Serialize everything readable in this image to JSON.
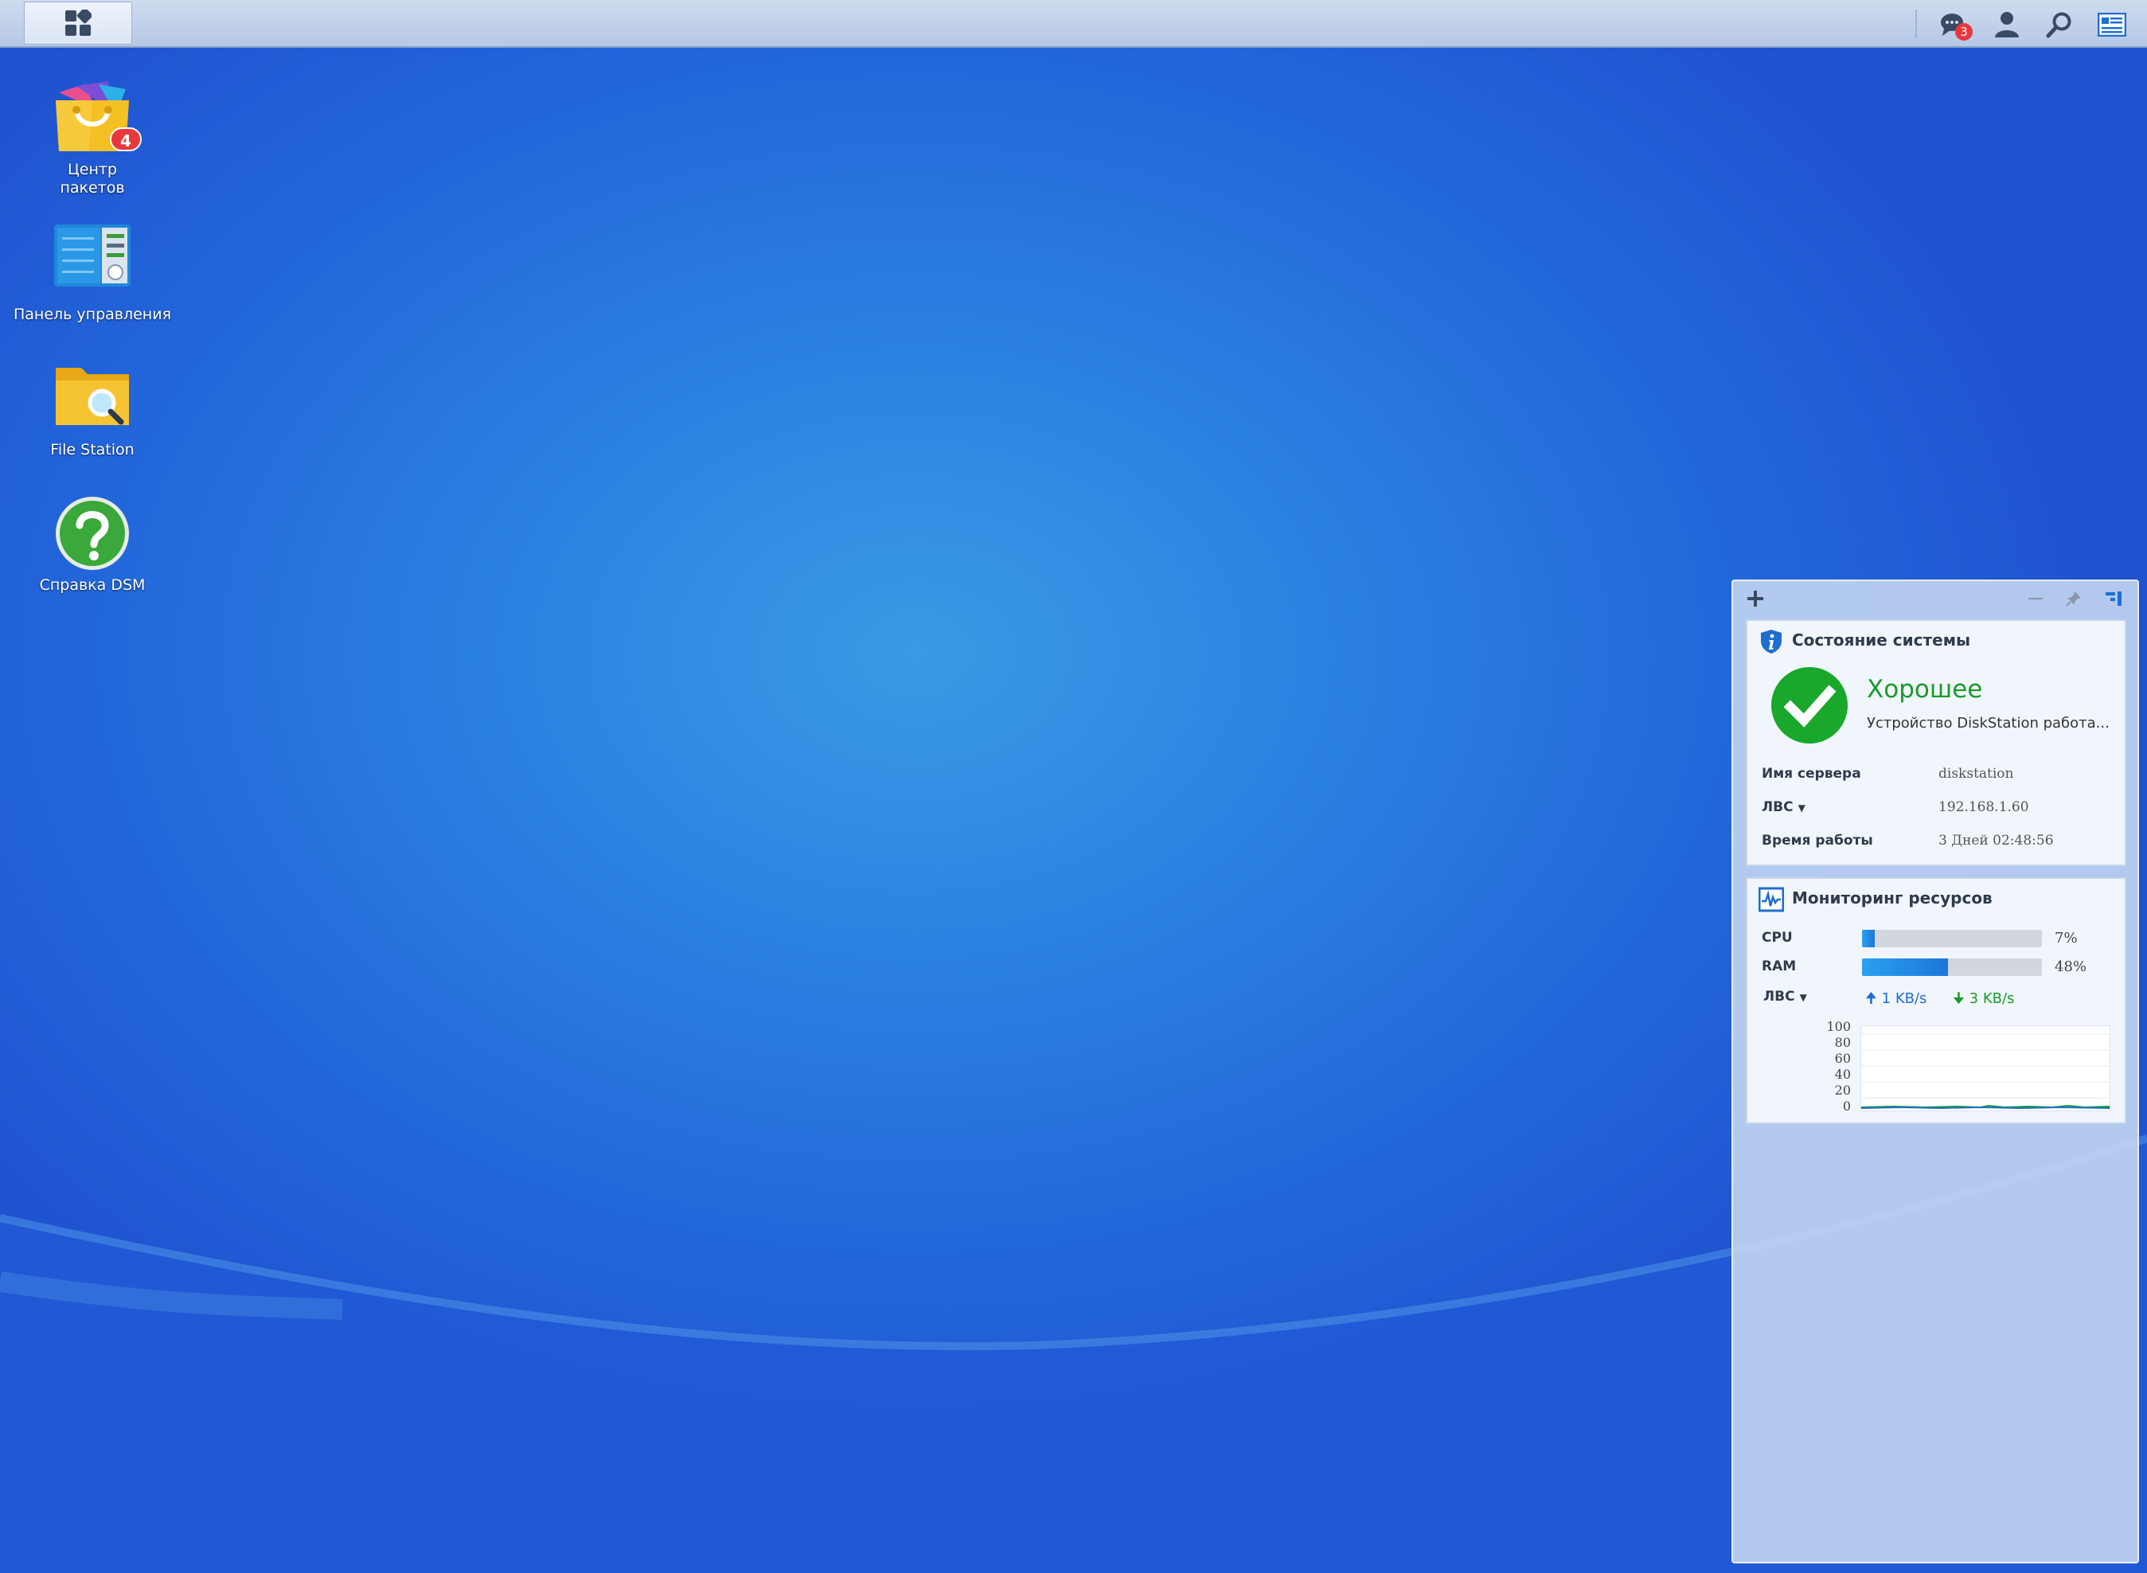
{
  "taskbar": {
    "notifications_count": "3"
  },
  "desktop": {
    "icons": [
      {
        "label": "Центр\nпакетов",
        "badge": "4",
        "icon": "package-center-icon"
      },
      {
        "label": "Панель управления",
        "icon": "control-panel-icon"
      },
      {
        "label": "File Station",
        "icon": "file-station-icon"
      },
      {
        "label": "Справка DSM",
        "icon": "dsm-help-icon"
      }
    ]
  },
  "widgets": {
    "system_health": {
      "title": "Состояние системы",
      "status": "Хорошее",
      "description": "Устройство DiskStation работа...",
      "server_name_label": "Имя сервера",
      "server_name": "diskstation",
      "lan_label": "ЛВС",
      "lan_ip": "192.168.1.60",
      "uptime_label": "Время работы",
      "uptime": "3 Дней 02:48:56"
    },
    "resource_monitor": {
      "title": "Мониторинг ресурсов",
      "cpu_label": "CPU",
      "cpu_percent": 7,
      "cpu_text": "7%",
      "ram_label": "RAM",
      "ram_percent": 48,
      "ram_text": "48%",
      "lan_label": "ЛВС",
      "upload": "1 KB/s",
      "download": "3 KB/s",
      "y_ticks": [
        "100",
        "80",
        "60",
        "40",
        "20",
        "0"
      ]
    }
  },
  "colors": {
    "accent": "#1d76d8",
    "good": "#1a9a2b",
    "badge": "#e8383b"
  }
}
